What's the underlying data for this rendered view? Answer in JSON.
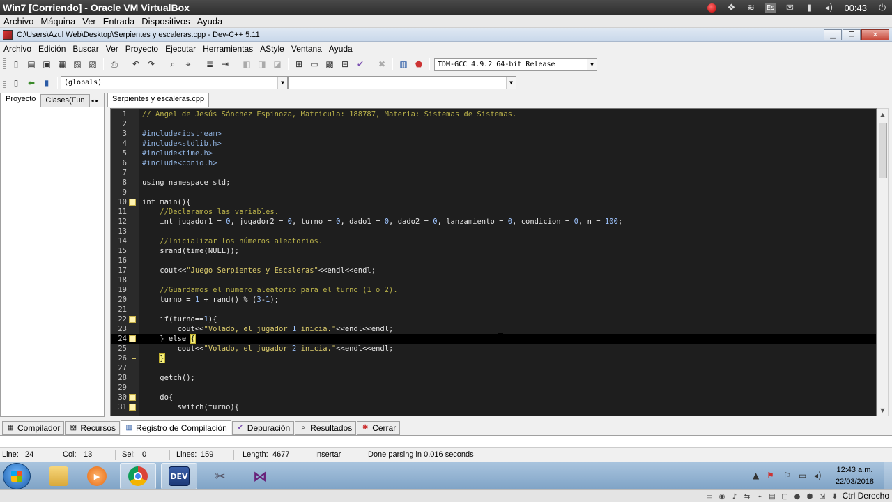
{
  "vbox": {
    "title": "Win7 [Corriendo] - Oracle VM VirtualBox",
    "menu": [
      "Archivo",
      "Máquina",
      "Ver",
      "Entrada",
      "Dispositivos",
      "Ayuda"
    ],
    "clock": "00:43",
    "host_key": "Ctrl Derecho",
    "tray_lang": "Es"
  },
  "devcpp": {
    "title": "C:\\Users\\Azul Web\\Desktop\\Serpientes y escaleras.cpp - Dev-C++ 5.11",
    "menu": [
      "Archivo",
      "Edición",
      "Buscar",
      "Ver",
      "Proyecto",
      "Ejecutar",
      "Herramientas",
      "AStyle",
      "Ventana",
      "Ayuda"
    ],
    "compiler_select": "TDM-GCC 4.9.2 64-bit Release",
    "scope_select": "(globals)",
    "left_tabs": [
      "Proyecto",
      "Clases(Fun"
    ],
    "editor_tab": "Serpientes y escaleras.cpp",
    "bottom_tabs": [
      "Compilador",
      "Recursos",
      "Registro de Compilación",
      "Depuración",
      "Resultados",
      "Cerrar"
    ],
    "status": {
      "line_label": "Line:",
      "line": "24",
      "col_label": "Col:",
      "col": "13",
      "sel_label": "Sel:",
      "sel": "0",
      "lines_label": "Lines:",
      "lines": "159",
      "length_label": "Length:",
      "length": "4677",
      "mode": "Insertar",
      "message": "Done parsing in 0.016 seconds"
    }
  },
  "code_lines": [
    {
      "n": "1",
      "t": "// Angel de Jesús Sánchez Espinoza, Matricula: 188787, Materia: Sistemas de Sistemas."
    },
    {
      "n": "2",
      "t": ""
    },
    {
      "n": "3",
      "t": "#include<iostream>"
    },
    {
      "n": "4",
      "t": "#include<stdlib.h>"
    },
    {
      "n": "5",
      "t": "#include<time.h>"
    },
    {
      "n": "6",
      "t": "#include<conio.h>"
    },
    {
      "n": "7",
      "t": ""
    },
    {
      "n": "8",
      "t": "using namespace std;"
    },
    {
      "n": "9",
      "t": ""
    },
    {
      "n": "10",
      "t": "int main(){"
    },
    {
      "n": "11",
      "t": "    //Declaramos las variables."
    },
    {
      "n": "12",
      "t": "    int jugador1 = 0, jugador2 = 0, turno = 0, dado1 = 0, dado2 = 0, lanzamiento = 0, condicion = 0, n = 100;"
    },
    {
      "n": "13",
      "t": ""
    },
    {
      "n": "14",
      "t": "    //Inicializar los números aleatorios."
    },
    {
      "n": "15",
      "t": "    srand(time(NULL));"
    },
    {
      "n": "16",
      "t": ""
    },
    {
      "n": "17",
      "t": "    cout<<\"Juego Serpientes y Escaleras\"<<endl<<endl;"
    },
    {
      "n": "18",
      "t": ""
    },
    {
      "n": "19",
      "t": "    //Guardamos el numero aleatorio para el turno (1 o 2)."
    },
    {
      "n": "20",
      "t": "    turno = 1 + rand() % (3-1);"
    },
    {
      "n": "21",
      "t": ""
    },
    {
      "n": "22",
      "t": "    if(turno==1){"
    },
    {
      "n": "23",
      "t": "        cout<<\"Volado, el jugador 1 inicia.\"<<endl<<endl;"
    },
    {
      "n": "24",
      "t": "    } else {"
    },
    {
      "n": "25",
      "t": "        cout<<\"Volado, el jugador 2 inicia.\"<<endl<<endl;"
    },
    {
      "n": "26",
      "t": "    }"
    },
    {
      "n": "27",
      "t": ""
    },
    {
      "n": "28",
      "t": "    getch();"
    },
    {
      "n": "29",
      "t": ""
    },
    {
      "n": "30",
      "t": "    do{"
    },
    {
      "n": "31",
      "t": "        switch(turno){"
    }
  ],
  "current_line": "24",
  "taskbar": {
    "clock_time": "12:43 a.m.",
    "clock_date": "22/03/2018",
    "apps": [
      "windows-explorer",
      "media-player",
      "chrome",
      "dev-cpp",
      "tools",
      "visual-studio"
    ],
    "devcpp_label": "DEV"
  }
}
